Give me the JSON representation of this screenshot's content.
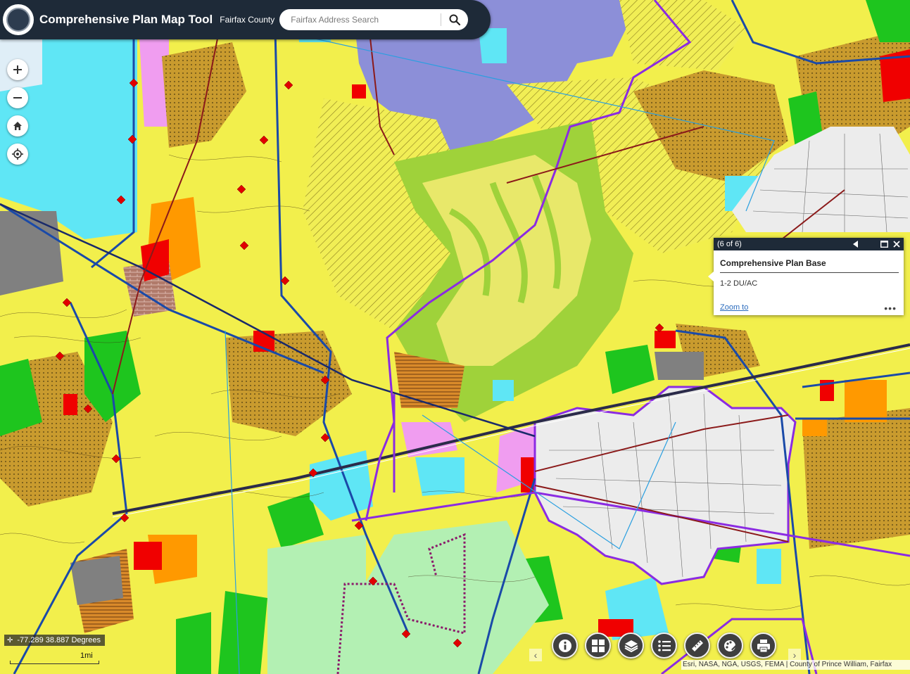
{
  "header": {
    "title": "Comprehensive Plan Map Tool",
    "subtitle": "Fairfax County",
    "search_placeholder": "Fairfax Address Search"
  },
  "icons": {
    "logo": "county-seal-icon",
    "search": "search-icon",
    "zoom_in": "plus-icon",
    "zoom_out": "minus-icon",
    "home": "home-icon",
    "locate": "locate-icon",
    "toolbar": [
      "info-icon",
      "basemap-gallery-icon",
      "layers-icon",
      "legend-icon",
      "measure-icon",
      "draw-icon",
      "print-icon"
    ]
  },
  "popup": {
    "count": "(6 of 6)",
    "title": "Comprehensive Plan Base",
    "value": "1-2 DU/AC",
    "zoom_link": "Zoom to",
    "more": "•••"
  },
  "status": {
    "coordinates": "-77.289 38.887 Degrees",
    "scale_label": "1mi"
  },
  "attribution": "Esri, NASA, NGA, USGS, FEMA | County of Prince William, Fairfax",
  "colors": {
    "header": "#1e2a38",
    "low_density_residential": "#f2ef4c",
    "medium_residential": "#d4a52a",
    "parks": "#1ec51e",
    "open_space": "#9fd23a",
    "industrial": "#8c8fd8",
    "commercial": "#f00000",
    "public_facilities": "#5fe6f5",
    "office": "#f09df0",
    "mixed_use": "#ff9900",
    "town_area": "#ececec"
  }
}
